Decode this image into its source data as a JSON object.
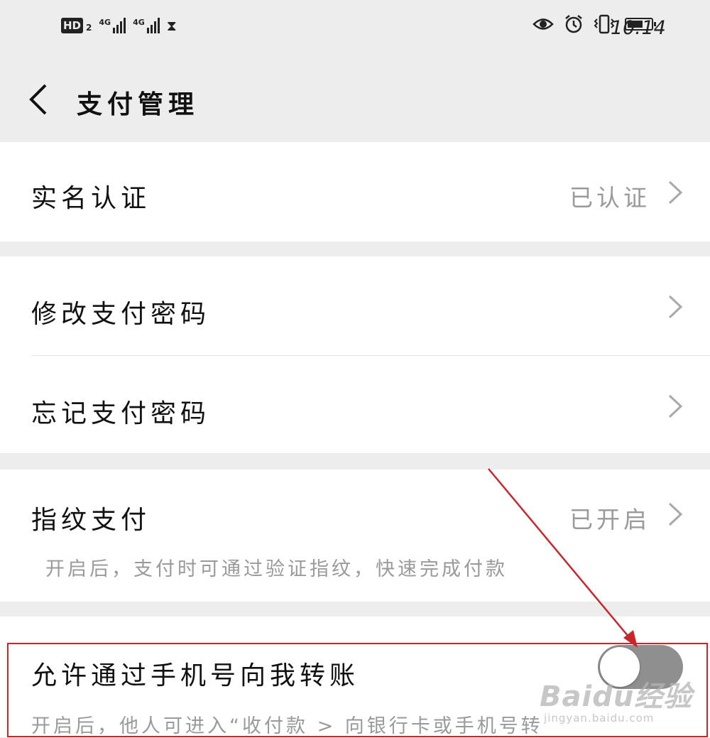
{
  "status_bar": {
    "hd_badge": "HD",
    "sim_number": "2",
    "network_1": "4G",
    "network_2": "4G",
    "time": "10:14",
    "icons": [
      "eye-icon",
      "alarm-icon",
      "vibrate-icon",
      "battery-icon",
      "hourglass-icon"
    ]
  },
  "header": {
    "title": "支付管理"
  },
  "sections": {
    "real_name": {
      "label": "实名认证",
      "value": "已认证"
    },
    "change_password": {
      "label": "修改支付密码"
    },
    "forgot_password": {
      "label": "忘记支付密码"
    },
    "fingerprint": {
      "label": "指纹支付",
      "value": "已开启",
      "description": "开启后，支付时可通过验证指纹，快速完成付款"
    },
    "phone_transfer": {
      "label": "允许通过手机号向我转账",
      "description": "开启后，他人可进入“收付款 > 向银行卡或手机号转",
      "toggle_on": false
    }
  },
  "annotation": {
    "color": "#c8262b"
  },
  "watermark": {
    "brand": "Baidu经验",
    "site": "jingyan.baidu.com"
  }
}
